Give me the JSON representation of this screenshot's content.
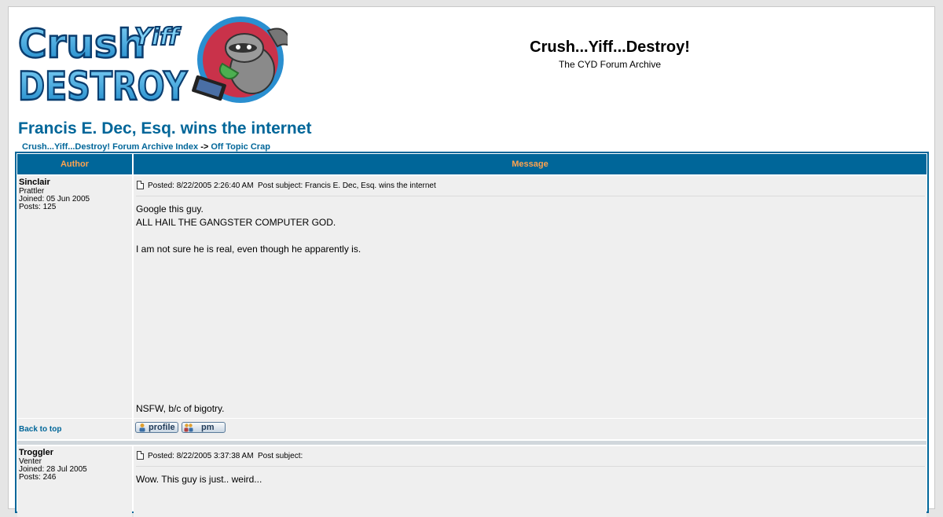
{
  "header": {
    "logo_line1": "Crush",
    "logo_line1b": "Yiff",
    "logo_line2": "DESTROY",
    "site_title": "Crush...Yiff...Destroy!",
    "site_subtitle": "The CYD Forum Archive"
  },
  "topic": {
    "title": "Francis E. Dec, Esq. wins the internet",
    "breadcrumb": {
      "index": "Crush...Yiff...Destroy! Forum Archive Index",
      "separator": "->",
      "forum": "Off Topic Crap"
    }
  },
  "table": {
    "col_author": "Author",
    "col_message": "Message"
  },
  "posts": [
    {
      "author": "Sinclair",
      "rank": "Prattler",
      "joined": "Joined: 05 Jun 2005",
      "posts": "Posts: 125",
      "posted": "Posted: 8/22/2005 2:26:40 AM",
      "subject": "Post subject: Francis E. Dec, Esq. wins the internet",
      "body": [
        "Google this guy.",
        "ALL HAIL THE GANGSTER COMPUTER GOD.",
        "I am not sure he is real, even though he apparently is.",
        "NSFW, b/c of bigotry."
      ],
      "back_to_top": "Back to top",
      "profile_label": "profile",
      "pm_label": "pm"
    },
    {
      "author": "Troggler",
      "rank": "Venter",
      "joined": "Joined: 28 Jul 2005",
      "posts": "Posts: 246",
      "posted": "Posted: 8/22/2005 3:37:38 AM",
      "subject": "Post subject:",
      "body": [
        "Wow. This guy is just.. weird..."
      ]
    }
  ],
  "colors": {
    "header_bg": "#006699",
    "header_text": "#ffa34f",
    "link": "#006699",
    "row_bg": "#efefef"
  },
  "icons": [
    "post-icon",
    "raccoon-mascot-icon",
    "profile-icon",
    "pm-icon"
  ]
}
